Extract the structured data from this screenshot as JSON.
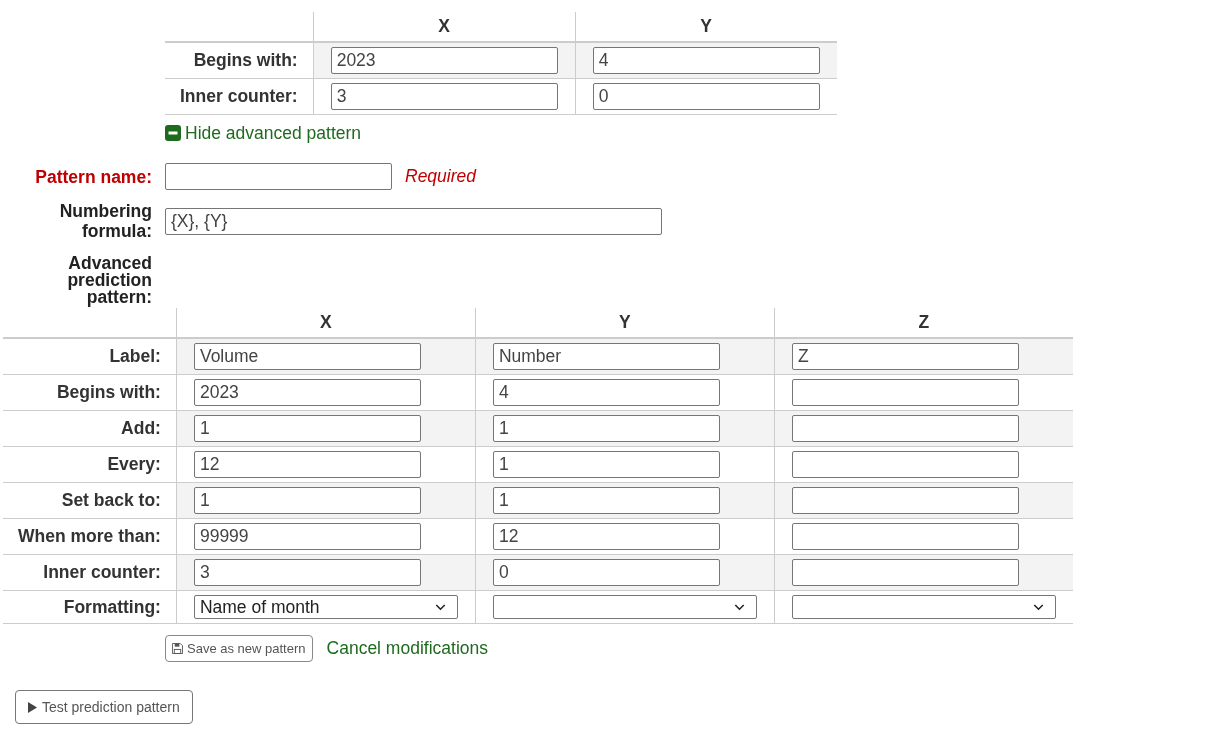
{
  "top_table": {
    "columns": [
      "X",
      "Y"
    ],
    "rows": [
      {
        "label": "Begins with:",
        "values": [
          "2023",
          "4"
        ]
      },
      {
        "label": "Inner counter:",
        "values": [
          "3",
          "0"
        ]
      }
    ]
  },
  "advanced_toggle": {
    "label": "Hide advanced pattern",
    "expanded": true
  },
  "pattern_name": {
    "label": "Pattern name:",
    "required": true,
    "note": "Required"
  },
  "numbering_formula": {
    "label": "Numbering formula:",
    "value": "{X}, {Y}"
  },
  "advanced_pattern": {
    "label": "Advanced prediction pattern:",
    "columns": [
      "X",
      "Y",
      "Z"
    ],
    "rows": [
      {
        "label": "Label:",
        "kind": "input",
        "cells": [
          {
            "value": "Volume"
          },
          {
            "value": "Number"
          },
          {
            "value": "Z"
          }
        ]
      },
      {
        "label": "Begins with:",
        "kind": "input",
        "cells": [
          {
            "value": "2023"
          },
          {
            "value": "4"
          },
          {}
        ]
      },
      {
        "label": "Add:",
        "kind": "input",
        "cells": [
          {
            "value": "1"
          },
          {
            "value": "1"
          },
          {}
        ]
      },
      {
        "label": "Every:",
        "kind": "input",
        "cells": [
          {
            "value": "12"
          },
          {
            "value": "1"
          },
          {}
        ]
      },
      {
        "label": "Set back to:",
        "kind": "input",
        "cells": [
          {
            "value": "1"
          },
          {
            "value": "1"
          },
          {}
        ]
      },
      {
        "label": "When more than:",
        "kind": "input",
        "cells": [
          {
            "value": "99999"
          },
          {
            "value": "12"
          },
          {}
        ]
      },
      {
        "label": "Inner counter:",
        "kind": "input",
        "cells": [
          {
            "value": "3"
          },
          {
            "value": "0"
          },
          {}
        ]
      },
      {
        "label": "Formatting:",
        "kind": "select",
        "cells": [
          {
            "value": "Name of month"
          },
          {},
          {}
        ]
      }
    ]
  },
  "actions": {
    "save_button": "Save as new pattern",
    "cancel_link": "Cancel modifications"
  },
  "test_button": "Test prediction pattern"
}
